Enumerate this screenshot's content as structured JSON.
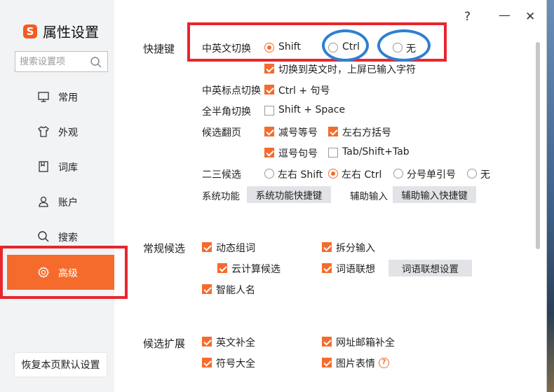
{
  "app": {
    "title": "属性设置",
    "logo_letter": "S",
    "brand_color": "#f56b2c"
  },
  "titlebar": {
    "help": "?",
    "minimize": "—",
    "close": "✕"
  },
  "search": {
    "placeholder": "搜索设置项"
  },
  "sidebar": {
    "items": [
      {
        "label": "常用",
        "icon": "monitor-icon",
        "active": false
      },
      {
        "label": "外观",
        "icon": "tshirt-icon",
        "active": false
      },
      {
        "label": "词库",
        "icon": "book-icon",
        "active": false
      },
      {
        "label": "账户",
        "icon": "user-icon",
        "active": false
      },
      {
        "label": "搜索",
        "icon": "search-icon",
        "active": false
      },
      {
        "label": "高级",
        "icon": "gear-icon",
        "active": true
      }
    ],
    "restore_label": "恢复本页默认设置"
  },
  "shortcuts": {
    "title": "快捷键",
    "cn_en_switch": {
      "label": "中英文切换",
      "options": [
        "Shift",
        "Ctrl",
        "无"
      ],
      "selected": "Shift"
    },
    "switch_note": {
      "label": "切换到英文时，上屏已输入字符",
      "checked": true
    },
    "punct_switch": {
      "label": "中英标点切换",
      "option": "Ctrl + 句号",
      "checked": true
    },
    "width_switch": {
      "label": "全半角切换",
      "option": "Shift + Space",
      "checked": false
    },
    "page_turn": {
      "label": "候选翻页",
      "options": [
        {
          "label": "减号等号",
          "checked": true
        },
        {
          "label": "左右方括号",
          "checked": true
        },
        {
          "label": "逗号句号",
          "checked": true
        },
        {
          "label": "Tab/Shift+Tab",
          "checked": false
        }
      ]
    },
    "second_third": {
      "label": "二三候选",
      "options": [
        "左右 Shift",
        "左右 Ctrl",
        "分号单引号",
        "无"
      ],
      "selected": "左右 Ctrl"
    },
    "system_function": {
      "label": "系统功能",
      "button": "系统功能快捷键"
    },
    "aux_input": {
      "label": "辅助输入",
      "button": "辅助输入快捷键"
    }
  },
  "candidates": {
    "title": "常规候选",
    "options": [
      {
        "label": "动态组词",
        "checked": true
      },
      {
        "label": "拆分输入",
        "checked": true
      },
      {
        "label": "云计算候选",
        "checked": true
      },
      {
        "label": "词语联想",
        "checked": true
      },
      {
        "label": "智能人名",
        "checked": true
      }
    ],
    "assoc_button": "词语联想设置"
  },
  "extension": {
    "title": "候选扩展",
    "options": [
      {
        "label": "英文补全",
        "checked": true
      },
      {
        "label": "网址邮箱补全",
        "checked": true
      },
      {
        "label": "符号大全",
        "checked": true
      },
      {
        "label": "图片表情",
        "checked": true
      }
    ],
    "help": "?"
  }
}
